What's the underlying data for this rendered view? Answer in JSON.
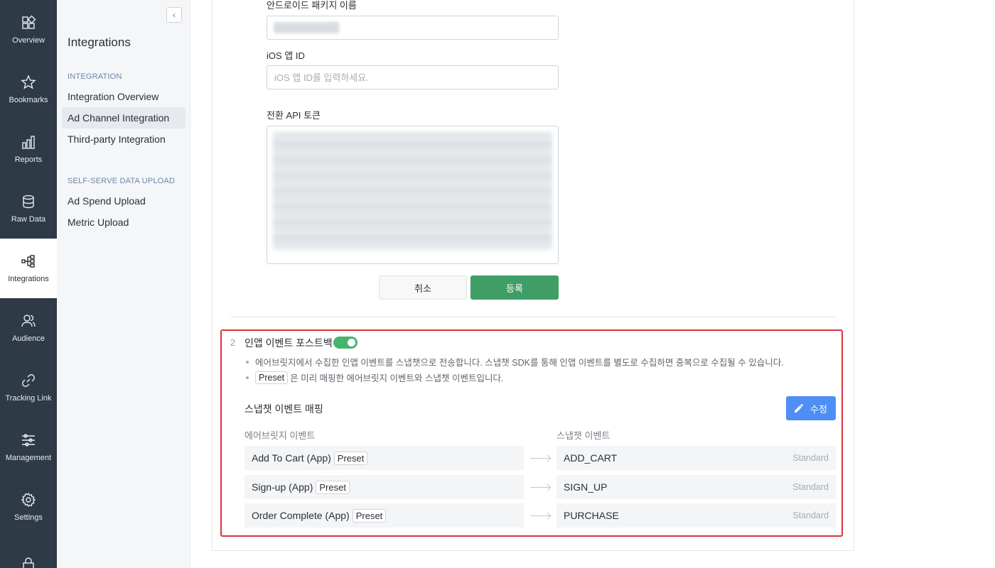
{
  "rail": [
    {
      "label": "Overview",
      "icon": "overview-icon"
    },
    {
      "label": "Bookmarks",
      "icon": "star-icon"
    },
    {
      "label": "Reports",
      "icon": "bar-chart-icon"
    },
    {
      "label": "Raw Data",
      "icon": "database-icon"
    },
    {
      "label": "Integrations",
      "icon": "integrations-icon",
      "active": true
    },
    {
      "label": "Audience",
      "icon": "audience-icon"
    },
    {
      "label": "Tracking Link",
      "icon": "link-icon"
    },
    {
      "label": "Management",
      "icon": "sliders-icon"
    },
    {
      "label": "Settings",
      "icon": "gear-icon"
    },
    {
      "label": "",
      "icon": "lock-icon"
    }
  ],
  "subnav": {
    "collapse_glyph": "‹",
    "title": "Integrations",
    "section1": "INTEGRATION",
    "items1": [
      "Integration Overview",
      "Ad Channel Integration",
      "Third-party Integration"
    ],
    "section2": "SELF-SERVE DATA UPLOAD",
    "items2": [
      "Ad Spend Upload",
      "Metric Upload"
    ]
  },
  "form": {
    "android_label": "안드로이드 패키지 이름",
    "ios_label": "iOS 앱 ID",
    "ios_placeholder": "iOS 앱 ID를 입력하세요.",
    "token_label": "전환 API 토큰",
    "cancel": "취소",
    "submit": "등록"
  },
  "postback": {
    "step": "2",
    "title": "인앱 이벤트 포스트백",
    "toggle_on": true,
    "bullet1": "에어브릿지에서 수집한 인앱 이벤트를 스냅챗으로 전송합니다. 스냅챗 SDK를 통해 인앱 이벤트를 별도로 수집하면 중복으로 수집될 수 있습니다.",
    "preset_tag": "Preset",
    "bullet2_suffix": "은 미리 매핑한 에어브릿지 이벤트와 스냅챗 이벤트입니다.",
    "mapping_title": "스냅챗 이벤트 매핑",
    "edit": "수정",
    "col_left": "에어브릿지 이벤트",
    "col_right": "스냅챗 이벤트",
    "rows": [
      {
        "source": "Add To Cart (App)",
        "tag": "Preset",
        "target": "ADD_CART",
        "type": "Standard"
      },
      {
        "source": "Sign-up (App)",
        "tag": "Preset",
        "target": "SIGN_UP",
        "type": "Standard"
      },
      {
        "source": "Order Complete (App)",
        "tag": "Preset",
        "target": "PURCHASE",
        "type": "Standard"
      }
    ]
  },
  "colors": {
    "rail_bg": "#2e3a45",
    "submit_green": "#3f9e66",
    "toggle_green": "#45b56e",
    "edit_blue": "#4f8ff5",
    "highlight_red": "#d9343a"
  }
}
